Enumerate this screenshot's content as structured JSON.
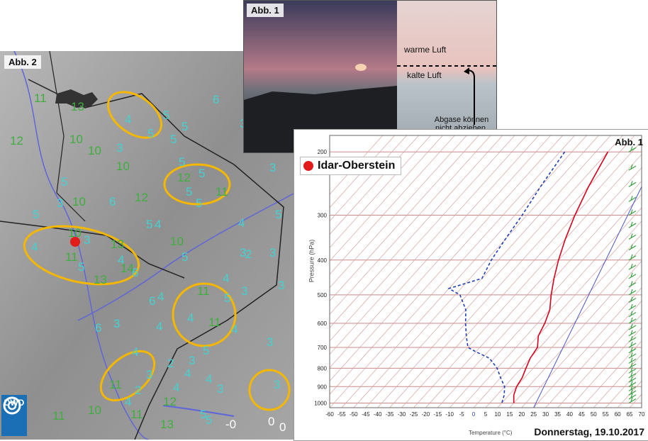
{
  "map_panel": {
    "label": "Abb. 2",
    "logo_text": "DWD",
    "station_marker_color": "#e21b1b",
    "ellipse_color": "#f5b700",
    "values_green": [
      {
        "t": "11"
      },
      {
        "t": "13"
      },
      {
        "t": "12"
      },
      {
        "t": "10"
      },
      {
        "t": "10"
      },
      {
        "t": "10"
      },
      {
        "t": "10"
      },
      {
        "t": "12"
      },
      {
        "t": "12"
      },
      {
        "t": "11"
      },
      {
        "t": "10"
      },
      {
        "t": "13"
      },
      {
        "t": "11"
      },
      {
        "t": "14"
      },
      {
        "t": "13"
      },
      {
        "t": "10"
      },
      {
        "t": "11"
      },
      {
        "t": "11"
      },
      {
        "t": "11"
      },
      {
        "t": "10"
      },
      {
        "t": "11"
      },
      {
        "t": "12"
      },
      {
        "t": "13"
      },
      {
        "t": "11"
      }
    ],
    "values_cyan": [
      {
        "t": "4"
      },
      {
        "t": "5"
      },
      {
        "t": "6"
      },
      {
        "t": "5"
      },
      {
        "t": "5"
      },
      {
        "t": "5"
      },
      {
        "t": "3"
      },
      {
        "t": "5"
      },
      {
        "t": "5"
      },
      {
        "t": "3"
      },
      {
        "t": "5"
      },
      {
        "t": "4"
      },
      {
        "t": "5"
      },
      {
        "t": "3"
      },
      {
        "t": "6"
      },
      {
        "t": "5"
      },
      {
        "t": "5"
      },
      {
        "t": "4"
      },
      {
        "t": "3"
      },
      {
        "t": "5"
      },
      {
        "t": "4"
      },
      {
        "t": "3"
      },
      {
        "t": "4"
      },
      {
        "t": "5"
      },
      {
        "t": "6"
      },
      {
        "t": "5"
      },
      {
        "t": "5"
      },
      {
        "t": "3"
      },
      {
        "t": "4"
      },
      {
        "t": "2"
      },
      {
        "t": "3"
      },
      {
        "t": "4"
      },
      {
        "t": "3"
      },
      {
        "t": "5"
      },
      {
        "t": "4"
      },
      {
        "t": "3"
      },
      {
        "t": "6"
      },
      {
        "t": "4"
      },
      {
        "t": "3"
      },
      {
        "t": "5"
      },
      {
        "t": "4"
      },
      {
        "t": "3"
      },
      {
        "t": "4"
      },
      {
        "t": "3"
      },
      {
        "t": "2"
      },
      {
        "t": "3"
      },
      {
        "t": "4"
      },
      {
        "t": "3"
      },
      {
        "t": "2"
      },
      {
        "t": "4"
      },
      {
        "t": "5"
      },
      {
        "t": "3"
      },
      {
        "t": "5"
      },
      {
        "t": "4"
      },
      {
        "t": "4"
      },
      {
        "t": "6"
      }
    ],
    "values_white": [
      {
        "t": "-0"
      },
      {
        "t": "0"
      },
      {
        "t": "0"
      }
    ]
  },
  "photo_panel": {
    "label": "Abb. 1",
    "warm": "warme Luft",
    "cold": "kalte Luft",
    "exhaust_line1": "Abgase können",
    "exhaust_line2": "nicht abziehen."
  },
  "sounding_panel": {
    "label": "Abb. 1",
    "station": "Idar-Oberstein",
    "date": "Donnerstag, 19.10.2017",
    "chart_data": {
      "type": "line",
      "title": "",
      "ylabel": "Pressure (hPa)",
      "xlabel": "Temperature (°C)",
      "y_ticks": [
        200,
        300,
        400,
        500,
        600,
        700,
        800,
        900,
        1000
      ],
      "x_ticks": [
        -60,
        -55,
        -50,
        -45,
        -40,
        -35,
        -30,
        -25,
        -20,
        -15,
        -10,
        -5,
        0,
        5,
        10,
        15,
        20,
        25,
        30,
        35,
        40,
        45,
        50,
        55,
        60,
        65,
        70
      ],
      "series": [
        {
          "color": "#d6001c",
          "points": [
            [
              -40,
              200
            ],
            [
              -35,
              250
            ],
            [
              -30,
              300
            ],
            [
              -25,
              350
            ],
            [
              -20,
              400
            ],
            [
              -15,
              450
            ],
            [
              -10,
              500
            ],
            [
              -5,
              550
            ],
            [
              -2,
              600
            ],
            [
              0,
              650
            ],
            [
              4,
              700
            ],
            [
              5,
              750
            ],
            [
              7,
              800
            ],
            [
              9,
              850
            ],
            [
              10,
              900
            ],
            [
              12,
              950
            ],
            [
              15,
              1000
            ]
          ]
        },
        {
          "color": "#1f3fb8",
          "points": [
            [
              -58,
              200
            ],
            [
              -55,
              250
            ],
            [
              -52,
              300
            ],
            [
              -50,
              350
            ],
            [
              -48,
              400
            ],
            [
              -45,
              450
            ],
            [
              -55,
              480
            ],
            [
              -48,
              500
            ],
            [
              -40,
              550
            ],
            [
              -35,
              600
            ],
            [
              -30,
              650
            ],
            [
              -25,
              700
            ],
            [
              -20,
              720
            ],
            [
              -12,
              750
            ],
            [
              -5,
              800
            ],
            [
              0,
              850
            ],
            [
              5,
              900
            ],
            [
              8,
              950
            ],
            [
              10,
              1000
            ]
          ]
        }
      ]
    }
  }
}
